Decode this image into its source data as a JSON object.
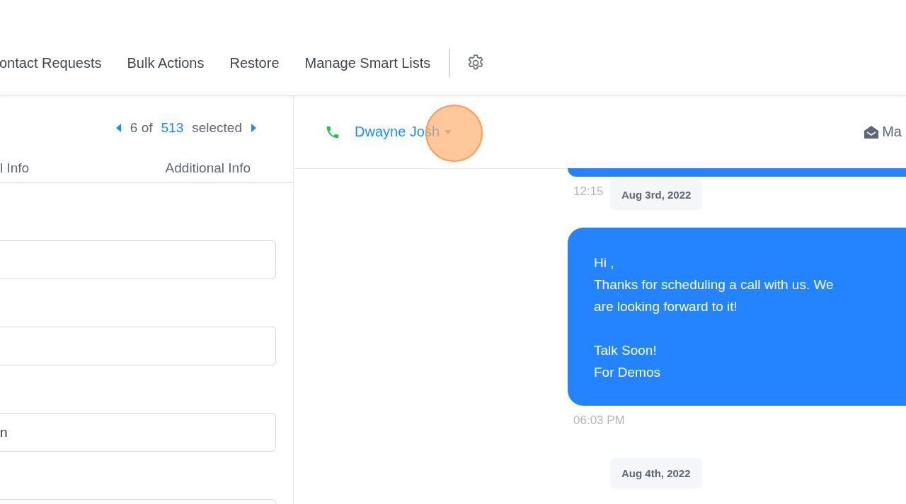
{
  "top_nav": {
    "items": [
      {
        "label": "ontact Requests"
      },
      {
        "label": "Bulk Actions"
      },
      {
        "label": "Restore"
      },
      {
        "label": "Manage Smart Lists"
      }
    ]
  },
  "contact_panel": {
    "pager": {
      "current": "6 of",
      "total": "513",
      "suffix": "selected"
    },
    "tabs": [
      {
        "label": "l Info",
        "selected": false
      },
      {
        "label": "Additional Info",
        "selected": false
      }
    ],
    "fields": [
      {
        "kind": "empty"
      },
      {
        "kind": "empty"
      },
      {
        "kind": "filled",
        "value": "n"
      },
      {
        "kind": "empty"
      }
    ]
  },
  "conversation": {
    "contact_name": "Dwayne Josh",
    "action": "Ma",
    "messages": [
      {
        "kind": "bubble_end",
        "time": "12:15"
      },
      {
        "kind": "date",
        "text": "Aug 3rd, 2022"
      },
      {
        "kind": "bubble",
        "paragraphs": [
          [
            "Hi ,",
            "Thanks for scheduling a call with us. We",
            "are looking forward to it!"
          ],
          [
            "Talk Soon!",
            "For Demos"
          ]
        ],
        "time": "06:03 PM"
      },
      {
        "kind": "date",
        "text": "Aug 4th, 2022"
      }
    ]
  }
}
